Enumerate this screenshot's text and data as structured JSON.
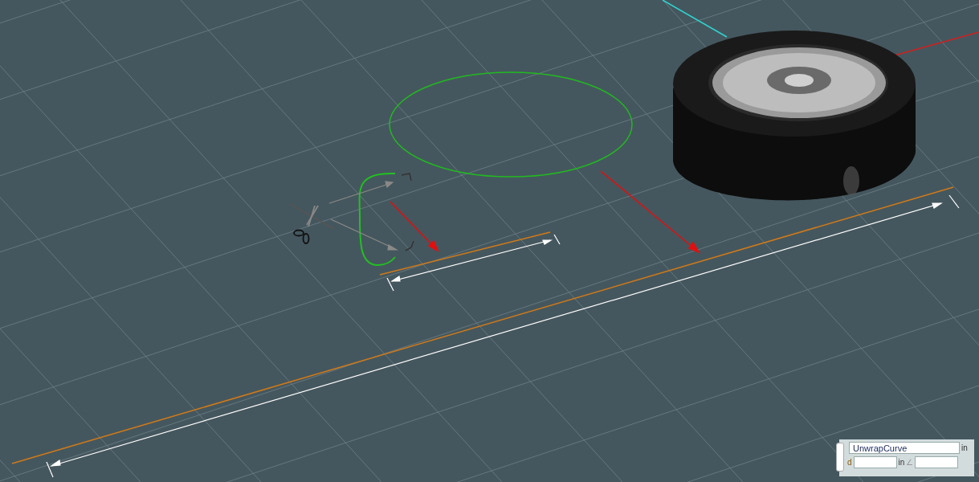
{
  "input_panel": {
    "name_field": {
      "value": "UnwrapCurve"
    },
    "unit_1": "in",
    "distance_label": "d",
    "unit_2": "in",
    "angle_symbol": "∠"
  }
}
